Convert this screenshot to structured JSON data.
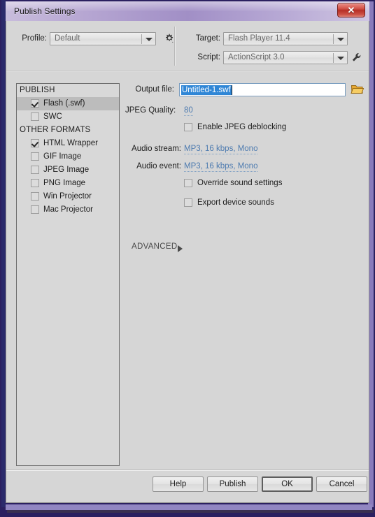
{
  "window": {
    "title": "Publish Settings",
    "close_label": "✕",
    "accent_purple": "#8a7bbc",
    "accent_navy": "#2b2a6b",
    "close_red": "#b52f26"
  },
  "top": {
    "profile_label": "Profile:",
    "profile_value": "Default",
    "profile_gear_icon": "gear-icon",
    "target_label": "Target:",
    "target_value": "Flash Player 11.4",
    "script_label": "Script:",
    "script_value": "ActionScript 3.0",
    "script_wrench_icon": "wrench-icon"
  },
  "format_list": {
    "groups": [
      {
        "header": "PUBLISH",
        "items": [
          {
            "label": "Flash (.swf)",
            "checked": true,
            "selected": true
          },
          {
            "label": "SWC",
            "checked": false,
            "selected": false
          }
        ]
      },
      {
        "header": "OTHER FORMATS",
        "items": [
          {
            "label": "HTML Wrapper",
            "checked": true,
            "selected": false
          },
          {
            "label": "GIF Image",
            "checked": false,
            "selected": false
          },
          {
            "label": "JPEG Image",
            "checked": false,
            "selected": false
          },
          {
            "label": "PNG Image",
            "checked": false,
            "selected": false
          },
          {
            "label": "Win Projector",
            "checked": false,
            "selected": false
          },
          {
            "label": "Mac Projector",
            "checked": false,
            "selected": false
          }
        ]
      }
    ]
  },
  "flash_settings": {
    "output_file_label": "Output file:",
    "output_file_value": "Untitled-1.swf",
    "output_file_selected": true,
    "browse_icon": "folder-icon",
    "jpeg_quality_label": "JPEG Quality:",
    "jpeg_quality_value": "80",
    "enable_jpeg_deblocking_label": "Enable JPEG deblocking",
    "enable_jpeg_deblocking_checked": false,
    "audio_stream_label": "Audio stream:",
    "audio_stream_value": "MP3, 16 kbps, Mono",
    "audio_event_label": "Audio event:",
    "audio_event_value": "MP3, 16 kbps, Mono",
    "override_sound_settings_label": "Override sound settings",
    "override_sound_settings_checked": false,
    "export_device_sounds_label": "Export device sounds",
    "export_device_sounds_checked": false,
    "advanced_label": "ADVANCED",
    "advanced_expanded": false
  },
  "footer": {
    "help_label": "Help",
    "publish_label": "Publish",
    "ok_label": "OK",
    "cancel_label": "Cancel"
  }
}
